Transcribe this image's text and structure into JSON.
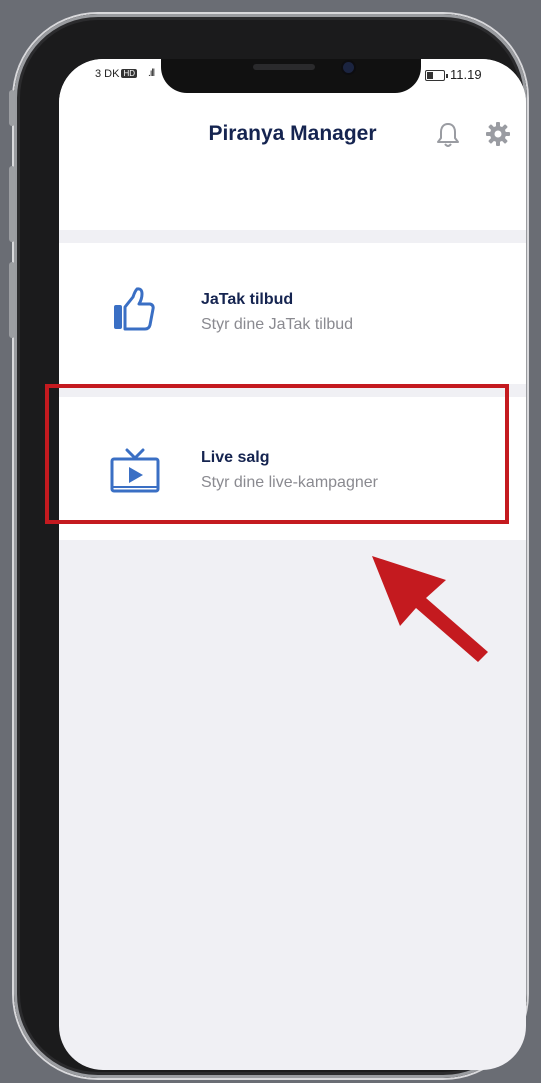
{
  "status_bar": {
    "carrier": "3 DK",
    "network_badge": "HD",
    "signal": ".ıll",
    "time": "11.19"
  },
  "header": {
    "title": "Piranya Manager",
    "icons": [
      "bell-icon",
      "gear-icon"
    ]
  },
  "menu": {
    "items": [
      {
        "title": "JaTak tilbud",
        "subtitle": "Styr dine JaTak tilbud",
        "icon": "thumbs-up-icon"
      },
      {
        "title": "Live salg",
        "subtitle": "Styr dine live-kampagner",
        "icon": "tv-play-icon"
      }
    ]
  },
  "annotation": {
    "highlight_color": "#c41a1f",
    "arrow_color": "#c41a1f"
  },
  "colors": {
    "brand_navy": "#152450",
    "icon_blue": "#3a6fc4",
    "subtitle_gray": "#8a8a90",
    "background": "#f0f0f4"
  }
}
